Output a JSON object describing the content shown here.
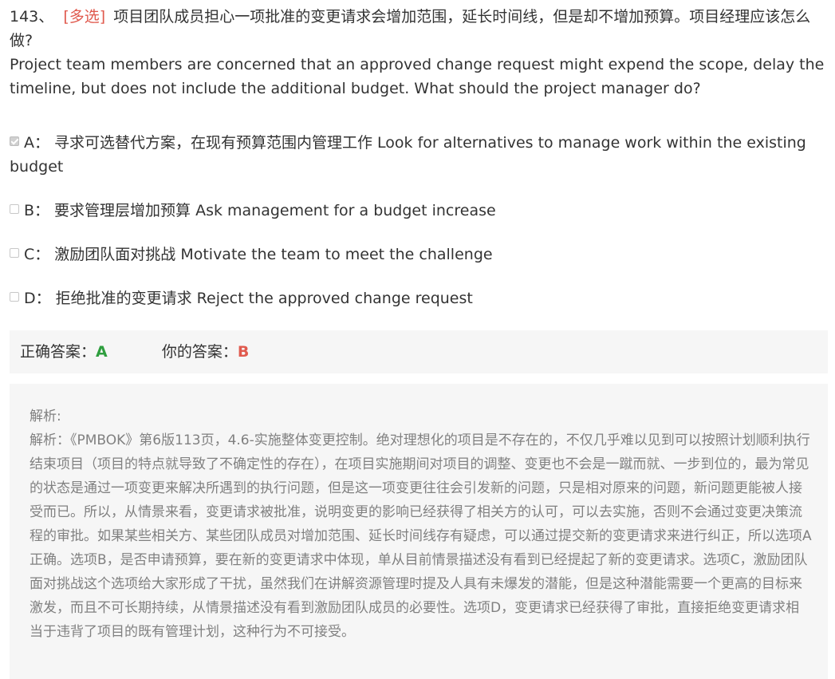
{
  "question": {
    "number": "143、",
    "type_tag": "[多选]",
    "text_zh": "项目团队成员担心一项批准的变更请求会增加范围，延长时间线，但是却不增加预算。项目经理应该怎么做?",
    "text_en": "Project team members are concerned that an approved change request might expend the scope, delay the timeline, but does not include the additional budget. What should the project manager do?"
  },
  "options": [
    {
      "letter": "A：",
      "text": "寻求可选替代方案，在现有预算范围内管理工作 Look for alternatives to manage work within the existing budget",
      "checked": true
    },
    {
      "letter": "B：",
      "text": "要求管理层增加预算 Ask management for a budget increase",
      "checked": false
    },
    {
      "letter": "C：",
      "text": "激励团队面对挑战 Motivate the team to meet the challenge",
      "checked": false
    },
    {
      "letter": "D：",
      "text": "拒绝批准的变更请求 Reject the approved change request",
      "checked": false
    }
  ],
  "answers": {
    "correct_label": "正确答案：",
    "correct_value": "A",
    "yours_label": "你的答案：",
    "yours_value": "B",
    "colors": {
      "correct": "#2e9e3e",
      "yours": "#e05a4e"
    }
  },
  "analysis": {
    "title": "解析:",
    "body": "解析：《PMBOK》第6版113页，4.6-实施整体变更控制。绝对理想化的项目是不存在的，不仅几乎难以见到可以按照计划顺利执行结束项目（项目的特点就导致了不确定性的存在），在项目实施期间对项目的调整、变更也不会是一蹴而就、一步到位的，最为常见的状态是通过一项变更来解决所遇到的执行问题，但是这一项变更往往会引发新的问题，只是相对原来的问题，新问题更能被人接受而已。所以，从情景来看，变更请求被批准，说明变更的影响已经获得了相关方的认可，可以去实施，否则不会通过变更决策流程的审批。如果某些相关方、某些团队成员对增加范围、延长时间线存有疑虑，可以通过提交新的变更请求来进行纠正，所以选项A正确。选项B，是否申请预算，要在新的变更请求中体现，单从目前情景描述没有看到已经提起了新的变更请求。选项C，激励团队面对挑战这个选项给大家形成了干扰，虽然我们在讲解资源管理时提及人具有未爆发的潜能，但是这种潜能需要一个更高的目标来激发，而且不可长期持续，从情景描述没有看到激励团队成员的必要性。选项D，变更请求已经获得了审批，直接拒绝变更请求相当于违背了项目的既有管理计划，这种行为不可接受。"
  }
}
